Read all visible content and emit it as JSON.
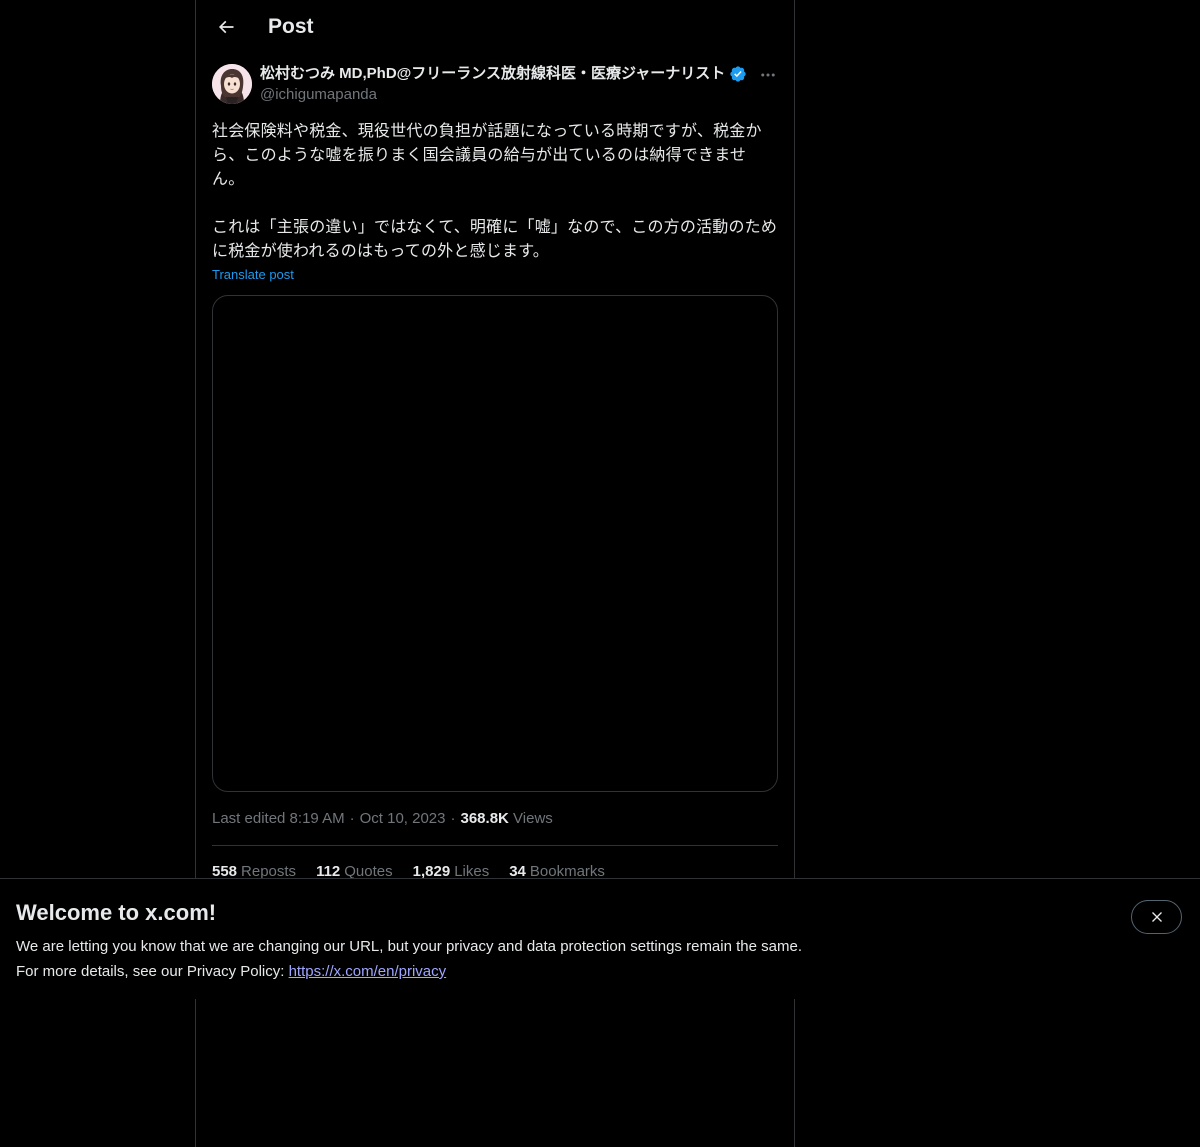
{
  "header": {
    "title": "Post"
  },
  "post": {
    "author_name": "松村むつみ MD,PhD@フリーランス放射線科医・医療ジャーナリスト",
    "author_handle": "@ichigumapanda",
    "verified": true,
    "text": "社会保険料や税金、現役世代の負担が話題になっている時期ですが、税金から、このような嘘を振りまく国会議員の給与が出ているのは納得できません。\n\nこれは「主張の違い」ではなくて、明確に「嘘」なので、この方の活動のために税金が使われるのはもっての外と感じます。",
    "translate_label": "Translate post",
    "last_edited": "Last edited 8:19 AM",
    "date": "Oct 10, 2023",
    "views_count": "368.8K",
    "views_label": "Views",
    "stats": {
      "reposts_count": "558",
      "reposts_label": "Reposts",
      "quotes_count": "112",
      "quotes_label": "Quotes",
      "likes_count": "1,829",
      "likes_label": "Likes",
      "bookmarks_count": "34",
      "bookmarks_label": "Bookmarks"
    }
  },
  "banner": {
    "title": "Welcome to x.com!",
    "line1": "We are letting you know that we are changing our URL, but your privacy and data protection settings remain the same.",
    "line2_prefix": "For more details, see our Privacy Policy: ",
    "link_text": "https://x.com/en/privacy"
  },
  "colors": {
    "background": "#000000",
    "text": "#e7e9ea",
    "muted": "#71767b",
    "accent": "#1d9bf0",
    "border": "#2f3336",
    "link": "#a0a6ff"
  },
  "icons": {
    "back": "arrow-left-icon",
    "verified": "verified-badge-icon",
    "more": "more-dots-icon",
    "close": "close-icon"
  }
}
